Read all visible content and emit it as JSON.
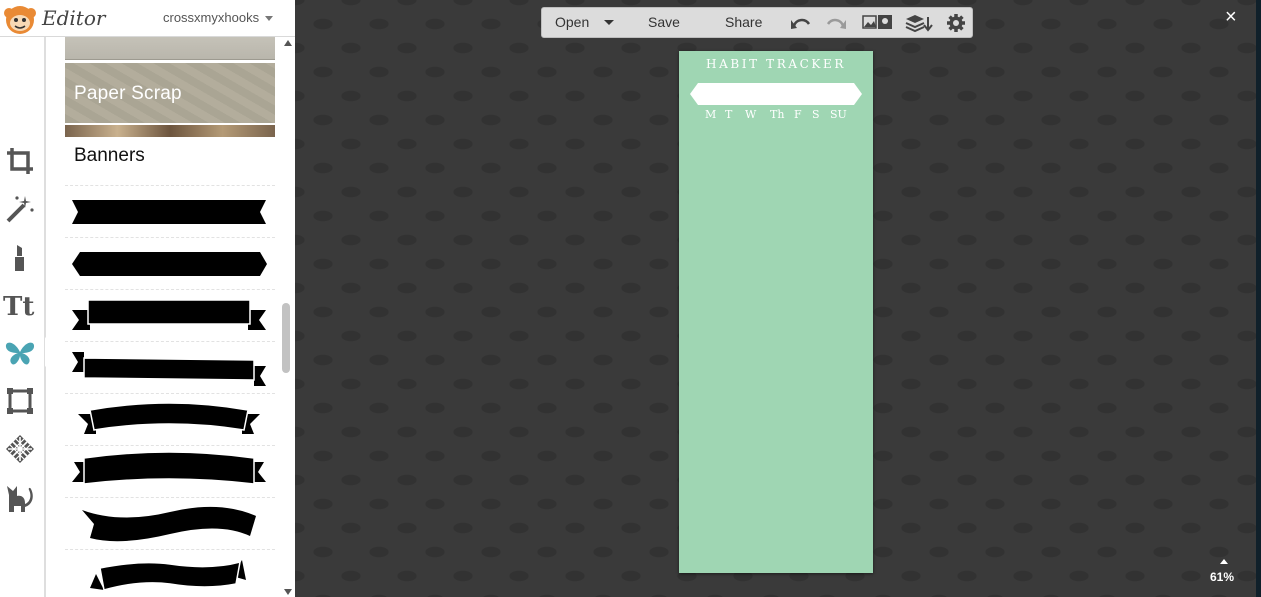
{
  "app": {
    "name": "Editor",
    "user": "crossxmyxhooks"
  },
  "panel": {
    "paper_scrap_label": "Paper Scrap",
    "section_title": "Banners",
    "banner_count": 8
  },
  "toolbar": {
    "open": "Open",
    "save": "Save",
    "share": "Share"
  },
  "workspace": {
    "zoom": "61%",
    "close": "×"
  },
  "document": {
    "title": "HABIT TRACKER",
    "days": [
      "M",
      "T",
      "W",
      "Th",
      "F",
      "S",
      "SU"
    ],
    "background_color": "#9fd6b3"
  },
  "icons": [
    "crop-icon",
    "magic-wand-icon",
    "lipstick-icon",
    "text-icon",
    "butterfly-icon",
    "frame-icon",
    "texture-icon",
    "cat-icon",
    "undo-icon",
    "redo-icon",
    "image-icon",
    "layers-icon",
    "gear-icon"
  ]
}
